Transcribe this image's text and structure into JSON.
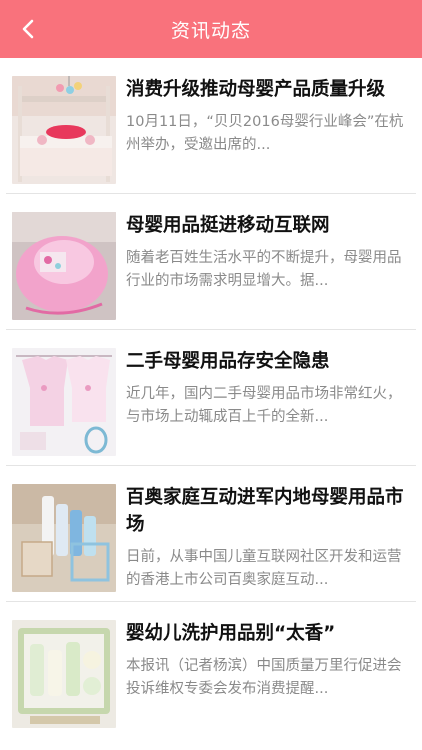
{
  "header": {
    "title": "资讯动态"
  },
  "items": [
    {
      "title": "消费升级推动母婴产品质量升级",
      "desc": "10月11日，“贝贝2016母婴行业峰会”在杭州举办，受邀出席的..."
    },
    {
      "title": "母婴用品挺进移动互联网",
      "desc": "随着老百姓生活水平的不断提升，母婴用品行业的市场需求明显增大。据..."
    },
    {
      "title": "二手母婴用品存安全隐患",
      "desc": "近几年，国内二手母婴用品市场非常红火，与市场上动辄成百上千的全新..."
    },
    {
      "title": "百奥家庭互动进军内地母婴用品市场",
      "desc": "日前，从事中国儿童互联网社区开发和运营的香港上市公司百奥家庭互动..."
    },
    {
      "title": "婴幼儿洗护用品别“太香”",
      "desc": "本报讯（记者杨滨）中国质量万里行促进会投诉维权专委会发布消费提醒..."
    }
  ]
}
